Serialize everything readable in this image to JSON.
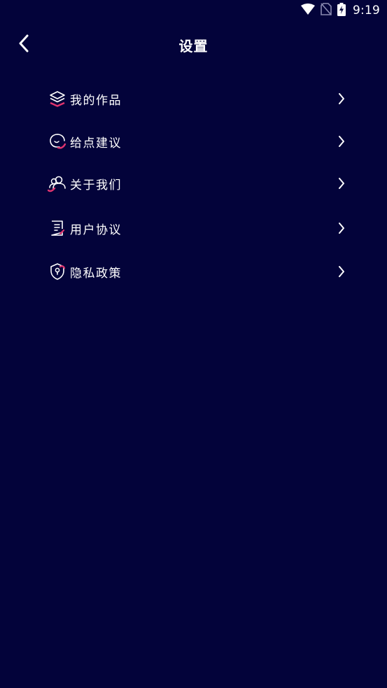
{
  "status_bar": {
    "time": "9:19",
    "icons": [
      "wifi-icon",
      "no-sim-icon",
      "battery-charging-icon"
    ]
  },
  "header": {
    "title": "设置",
    "back_icon": "chevron-left-icon"
  },
  "menu": {
    "items": [
      {
        "label": "我的作品",
        "icon": "layers-icon"
      },
      {
        "label": "给点建议",
        "icon": "chat-bubble-icon"
      },
      {
        "label": "关于我们",
        "icon": "people-icon"
      },
      {
        "label": "用户协议",
        "icon": "document-icon"
      },
      {
        "label": "隐私政策",
        "icon": "shield-lock-icon"
      }
    ]
  },
  "colors": {
    "background": "#03033a",
    "text": "#ffffff",
    "accent": "#e0336e"
  }
}
